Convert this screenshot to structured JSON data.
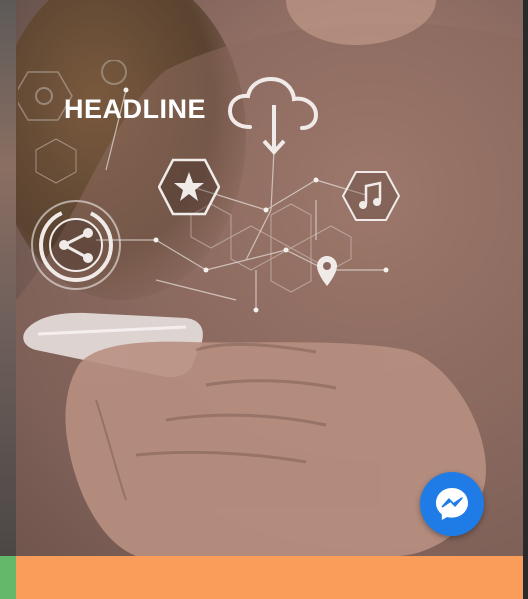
{
  "hero": {
    "headline": "HEADLINE"
  },
  "icons": {
    "cloud": "cloud-download-icon",
    "star": "star-icon",
    "music": "music-note-icon",
    "share": "share-icon",
    "location": "location-pin-icon",
    "chat": "messenger-icon"
  },
  "colors": {
    "messenger": "#1f7ce6",
    "cta_bar": "#fb9d5a",
    "left_accent": "#63b86a"
  }
}
